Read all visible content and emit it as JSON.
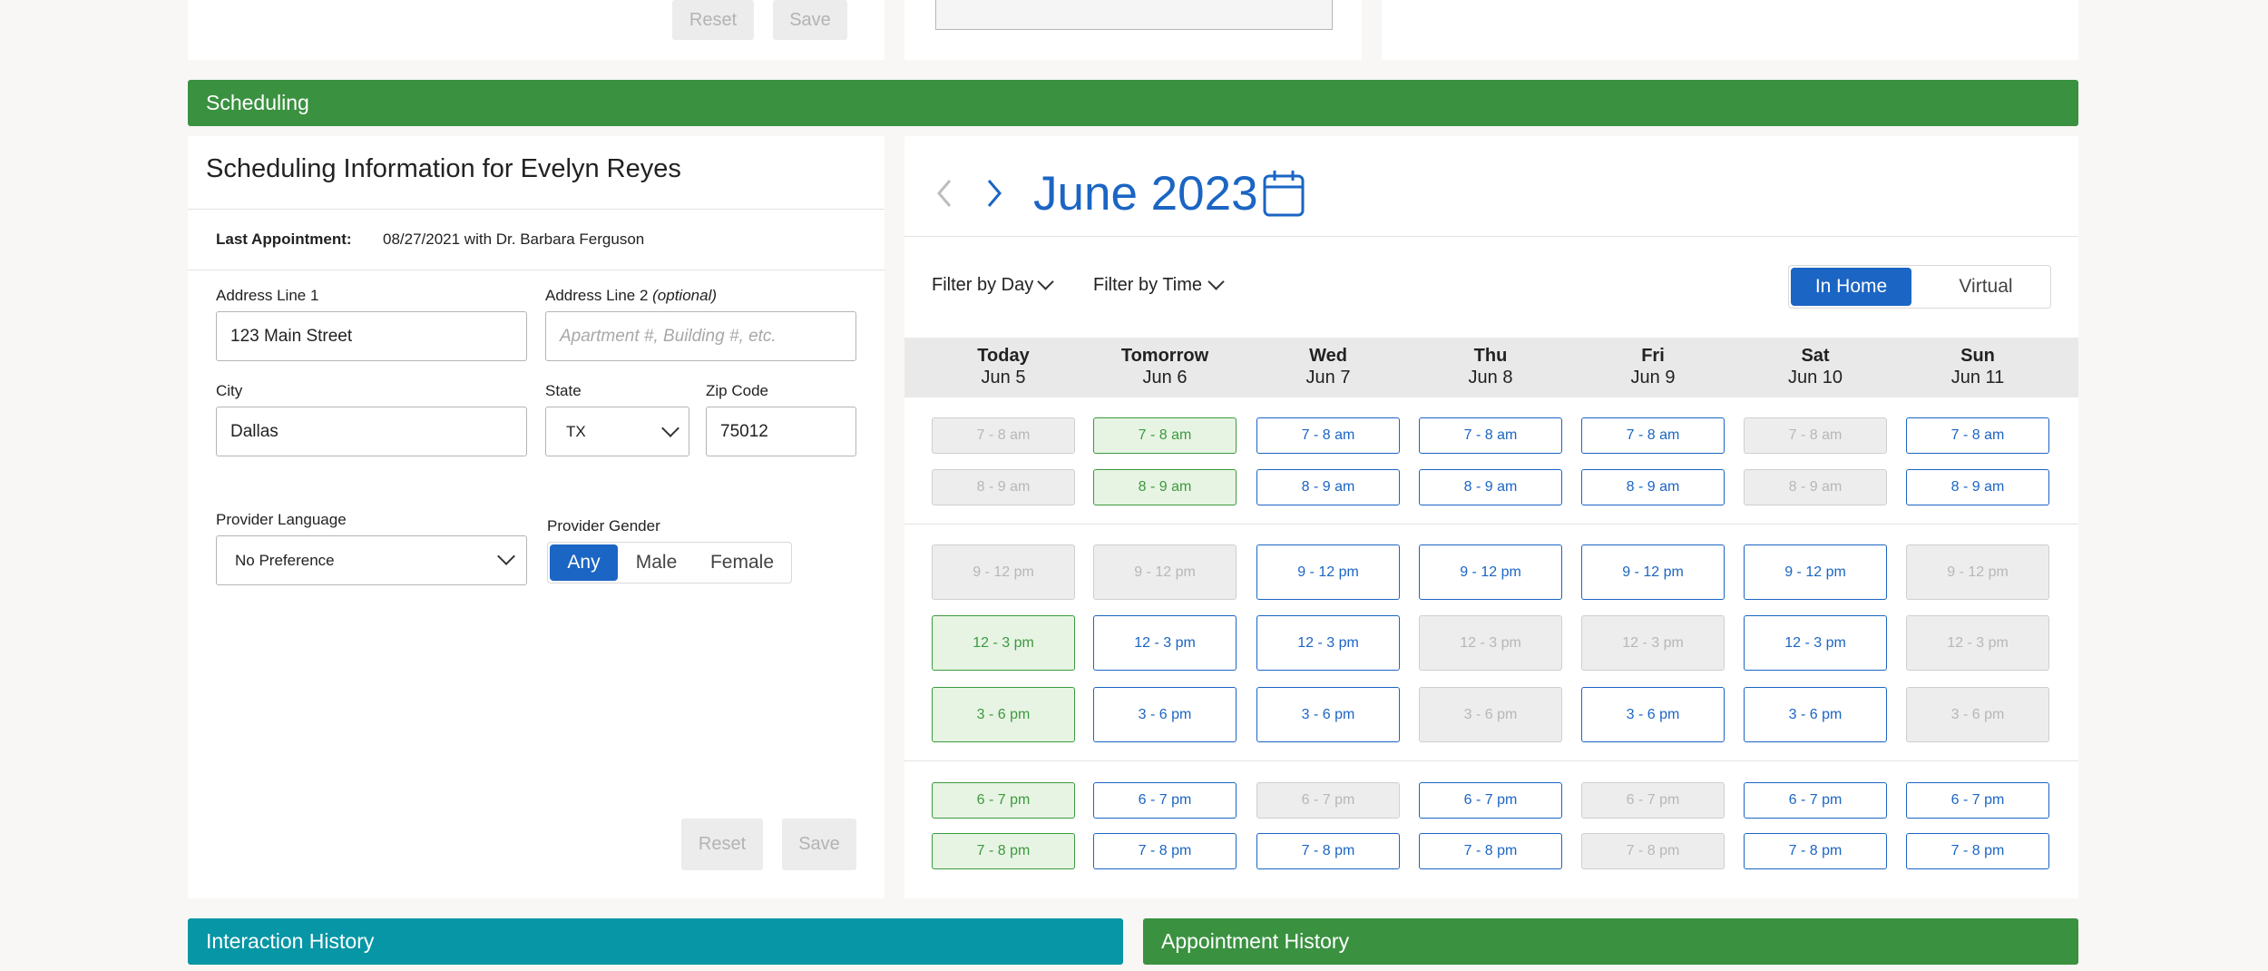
{
  "top_strip": {
    "reset_label": "Reset",
    "save_label": "Save"
  },
  "scheduling": {
    "bar_title": "Scheduling",
    "bar_color": "#3a9140",
    "form": {
      "heading": "Scheduling Information for Evelyn Reyes",
      "last_appt_label": "Last Appointment:",
      "last_appt_value": "08/27/2021 with Dr. Barbara Ferguson",
      "address1_label": "Address Line 1",
      "address1_value": "123 Main Street",
      "address2_label": "Address Line 2",
      "address2_optional": "(optional)",
      "address2_placeholder": "Apartment #, Building #, etc.",
      "city_label": "City",
      "city_value": "Dallas",
      "state_label": "State",
      "state_value": "TX",
      "zip_label": "Zip Code",
      "zip_value": "75012",
      "language_label": "Provider Language",
      "language_value": "No Preference",
      "gender_label": "Provider Gender",
      "gender_options": [
        "Any",
        "Male",
        "Female"
      ],
      "gender_selected": "Any",
      "reset_label": "Reset",
      "save_label": "Save"
    },
    "calendar": {
      "month_title": "June 2023",
      "filter_day_label": "Filter by Day",
      "filter_time_label": "Filter by Time",
      "visit_types": [
        "In Home",
        "Virtual"
      ],
      "visit_selected": "In Home",
      "accent_color": "#1b65c4",
      "days": [
        {
          "name": "Today",
          "date": "Jun 5"
        },
        {
          "name": "Tomorrow",
          "date": "Jun 6"
        },
        {
          "name": "Wed",
          "date": "Jun 7"
        },
        {
          "name": "Thu",
          "date": "Jun 8"
        },
        {
          "name": "Fri",
          "date": "Jun 9"
        },
        {
          "name": "Sat",
          "date": "Jun 10"
        },
        {
          "name": "Sun",
          "date": "Jun 11"
        }
      ],
      "time_slots": [
        "7 - 8 am",
        "8 - 9 am",
        "9 - 12 pm",
        "12 - 3 pm",
        "3 - 6 pm",
        "6 - 7 pm",
        "7 - 8 pm"
      ],
      "slot_status": [
        [
          "unavailable",
          "selected",
          "available",
          "available",
          "available",
          "unavailable",
          "available"
        ],
        [
          "unavailable",
          "selected",
          "available",
          "available",
          "available",
          "unavailable",
          "available"
        ],
        [
          "unavailable",
          "unavailable",
          "available",
          "available",
          "available",
          "available",
          "unavailable"
        ],
        [
          "selected",
          "available",
          "available",
          "unavailable",
          "unavailable",
          "available",
          "unavailable"
        ],
        [
          "selected",
          "available",
          "available",
          "unavailable",
          "available",
          "available",
          "unavailable"
        ],
        [
          "selected",
          "available",
          "unavailable",
          "available",
          "unavailable",
          "available",
          "available"
        ],
        [
          "selected",
          "available",
          "available",
          "available",
          "unavailable",
          "available",
          "available"
        ]
      ]
    }
  },
  "interaction_history": {
    "title": "Interaction History",
    "color": "#0696a6"
  },
  "appointment_history": {
    "title": "Appointment History",
    "color": "#3a9140"
  }
}
